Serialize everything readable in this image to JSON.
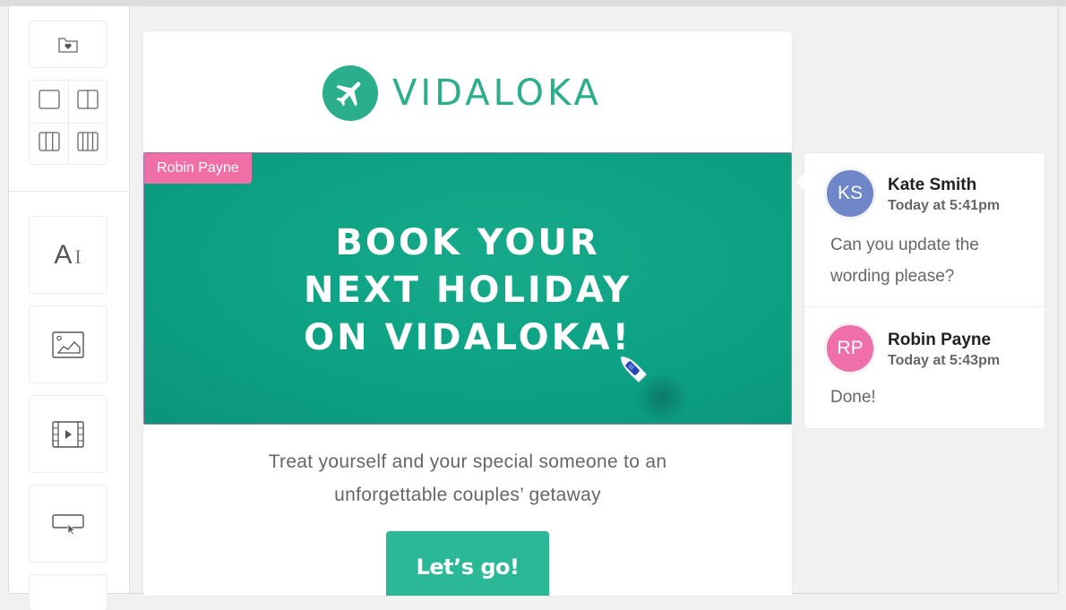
{
  "sidebar": {
    "tiles": [
      {
        "name": "saved-blocks",
        "icon": "folder-heart-icon"
      },
      {
        "name": "text-block",
        "icon": "text-icon",
        "glyph": "A",
        "cursor": "I"
      },
      {
        "name": "image-block",
        "icon": "image-icon"
      },
      {
        "name": "video-block",
        "icon": "video-icon"
      },
      {
        "name": "button-block",
        "icon": "button-icon"
      }
    ],
    "layouts": [
      {
        "name": "one-column",
        "icon": "layout-1col-icon"
      },
      {
        "name": "two-column",
        "icon": "layout-2col-icon"
      },
      {
        "name": "three-column",
        "icon": "layout-3col-icon"
      },
      {
        "name": "four-column",
        "icon": "layout-4col-icon"
      }
    ]
  },
  "email": {
    "brand": "VIDALOKA",
    "brand_color": "#2bae8c",
    "hero": {
      "tag": "Robin Payne",
      "tag_color": "#f06fa6",
      "title_lines": [
        "BOOK YOUR",
        "NEXT HOLIDAY",
        "ON VIDALOKA!"
      ]
    },
    "body_lines": [
      "Treat yourself and your special someone to an",
      "unforgettable couples’ getaway"
    ],
    "cta_label": "Let’s go!",
    "cta_color": "#2bb896"
  },
  "comments": [
    {
      "initials": "KS",
      "author": "Kate Smith",
      "time": "Today at 5:41pm",
      "text": "Can you update the wording please?",
      "avatar_color": "#6f86c9"
    },
    {
      "initials": "RP",
      "author": "Robin Payne",
      "time": "Today at 5:43pm",
      "text": "Done!",
      "avatar_color": "#ee6fa9"
    }
  ]
}
